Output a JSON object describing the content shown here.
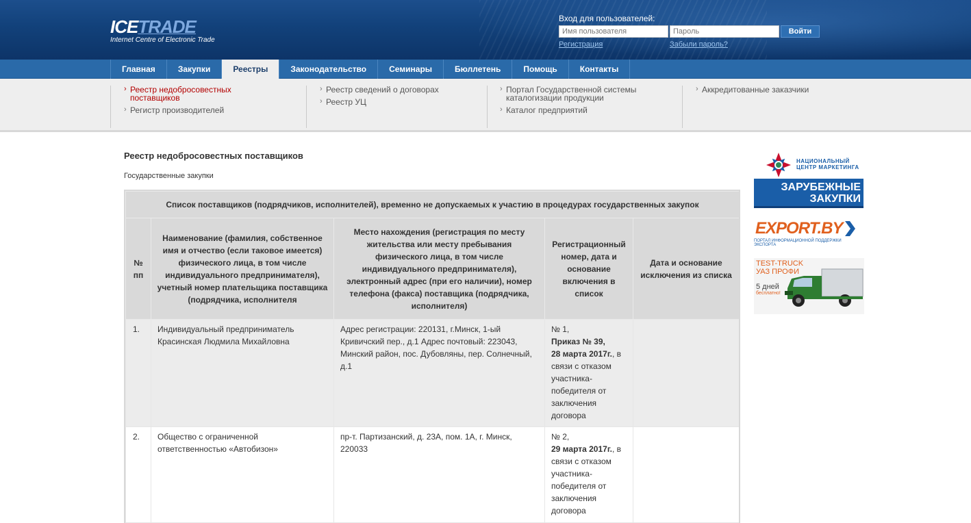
{
  "header": {
    "logo_main_ice": "ICE",
    "logo_main_trade": "TRADE",
    "logo_tagline": "Internet Centre of Electronic Trade",
    "login_label": "Вход для пользователей:",
    "username_placeholder": "Имя пользователя",
    "password_placeholder": "Пароль",
    "login_button": "Войти",
    "register_link": "Регистрация",
    "forgot_link": "Забыли пароль?"
  },
  "nav": {
    "tabs": [
      {
        "label": "Главная"
      },
      {
        "label": "Закупки"
      },
      {
        "label": "Реестры",
        "active": true
      },
      {
        "label": "Законодательство"
      },
      {
        "label": "Семинары"
      },
      {
        "label": "Бюллетень"
      },
      {
        "label": "Помощь"
      },
      {
        "label": "Контакты"
      }
    ]
  },
  "submenu": {
    "col1": [
      "Реестр недобросовестных поставщиков",
      "Регистр производителей"
    ],
    "col2": [
      "Реестр сведений о договорах",
      "Реестр УЦ"
    ],
    "col3": [
      "Портал Государственной системы каталогизации продукции",
      "Каталог предприятий"
    ],
    "col4": [
      "Аккредитованные заказчики"
    ]
  },
  "page": {
    "title": "Реестр недобросовестных поставщиков",
    "subtitle": "Государственные закупки"
  },
  "table": {
    "caption": "Список поставщиков (подрядчиков, исполнителей), временно не допускаемых к участию в процедурах государственных закупок",
    "headers": [
      "№ пп",
      "Наименование (фамилия, собственное имя и отчество (если таковое имеется) физического лица, в том числе индивидуального предпринимателя), учетный номер плательщика поставщика (подрядчика, исполнителя",
      "Место нахождения (регистрация по месту жительства или месту пребывания физического лица, в том числе индивидуального предпринимателя), электронный адрес (при его наличии), номер телефона (факса) поставщика (подрядчика, исполнителя)",
      "Регистрационный номер, дата и основание включения в список",
      "Дата и основание исключения из списка"
    ],
    "rows": [
      {
        "num": "1.",
        "name": "Индивидуальный предприниматель Красинская Людмила Михайловна",
        "address": "Адрес регистрации: 220131, г.Минск, 1-ый Кривичский пер., д.1 Адрес почтовый: 223043, Минский район, пос. Дубовляны, пер. Солнечный, д.1",
        "reg_no": "№ 1,",
        "reg_order": "Приказ № 39,",
        "reg_date": "28 марта 2017г.",
        "reg_reason": ", в связи с отказом участника-победителя от заключения договора",
        "exclusion": ""
      },
      {
        "num": "2.",
        "name": "Общество с ограниченной ответственностью «Автобизон»",
        "address": "пр-т. Партизанский, д. 23А, пом. 1А, г. Минск, 220033",
        "reg_no": "№ 2,",
        "reg_date": "29 марта 2017г.",
        "reg_reason": ", в связи с отказом участника-победителя от заключения договора",
        "exclusion": ""
      }
    ]
  },
  "banners": {
    "b1_org": "НАЦИОНАЛЬНЫЙ ЦЕНТР МАРКЕТИНГА",
    "b1_line1": "ЗАРУБЕЖНЫЕ",
    "b1_line2": "ЗАКУПКИ",
    "b2_word": "EXPORT.BY",
    "b2_sub": "ПОРТАЛ ИНФОРМАЦИОННОЙ ПОДДЕРЖКИ ЭКСПОРТА",
    "b3_line1": "TEST-TRUCK",
    "b3_line2": "УАЗ ПРОФИ",
    "b3_days": "5 дней",
    "b3_free": "бесплатно!"
  },
  "colors": {
    "header_blue": "#12417a",
    "nav_blue": "#2a6aa9",
    "active_red": "#b30000",
    "export_orange": "#e0601e"
  }
}
